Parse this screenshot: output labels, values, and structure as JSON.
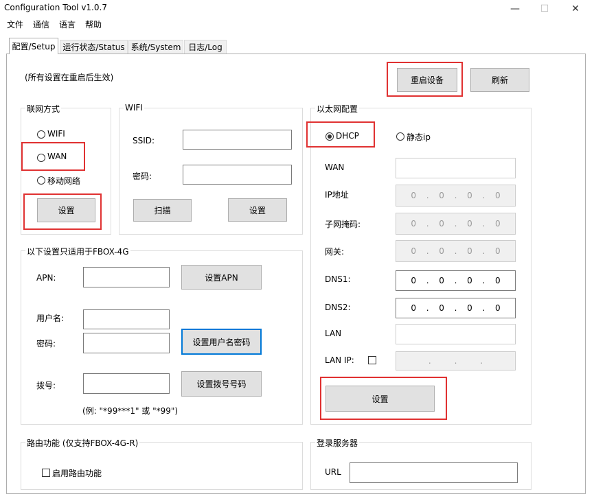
{
  "window": {
    "title": "Configuration Tool v1.0.7",
    "min": "—",
    "max": "☐",
    "close": "✕"
  },
  "menu": [
    "文件",
    "通信",
    "语言",
    "帮助"
  ],
  "tabs": [
    "配置/Setup",
    "运行状态/Status",
    "系统/System",
    "日志/Log"
  ],
  "note": "(所有设置在重启后生效)",
  "buttons": {
    "restart": "重启设备",
    "refresh": "刷新"
  },
  "network": {
    "title": "联网方式",
    "options": [
      "WIFI",
      "WAN",
      "移动网络"
    ],
    "set": "设置"
  },
  "wifi": {
    "title": "WIFI",
    "ssid_label": "SSID:",
    "password_label": "密码:",
    "scan": "扫描",
    "set": "设置"
  },
  "ethernet": {
    "title": "以太网配置",
    "dhcp": "DHCP",
    "static": "静态ip",
    "wan_label": "WAN",
    "ip_label": "IP地址",
    "mask_label": "子网掩码:",
    "gateway_label": "网关:",
    "dns1_label": "DNS1:",
    "dns2_label": "DNS2:",
    "lan_label": "LAN",
    "lanip_label": "LAN IP:",
    "ip": [
      "0",
      ".",
      "0",
      ".",
      "0",
      ".",
      "0"
    ],
    "mask": [
      "0",
      ".",
      "0",
      ".",
      "0",
      ".",
      "0"
    ],
    "gateway": [
      "0",
      ".",
      "0",
      ".",
      "0",
      ".",
      "0"
    ],
    "dns1": [
      "0",
      ".",
      "0",
      ".",
      "0",
      ".",
      "0"
    ],
    "dns2": [
      "0",
      ".",
      "0",
      ".",
      "0",
      ".",
      "0"
    ],
    "lanip": [
      ".",
      ".",
      "."
    ],
    "set": "设置"
  },
  "fbox": {
    "title": "以下设置只适用于FBOX-4G",
    "apn_label": "APN:",
    "set_apn": "设置APN",
    "username_label": "用户名:",
    "password_label": "密码:",
    "set_user": "设置用户名密码",
    "dial_label": "拨号:",
    "set_dial": "设置拨号号码",
    "dial_example": "(例: \"*99***1\" 或 \"*99\")"
  },
  "router": {
    "title": "路由功能 (仅支持FBOX-4G-R)",
    "enable": "启用路由功能"
  },
  "server": {
    "title": "登录服务器",
    "url_label": "URL"
  }
}
